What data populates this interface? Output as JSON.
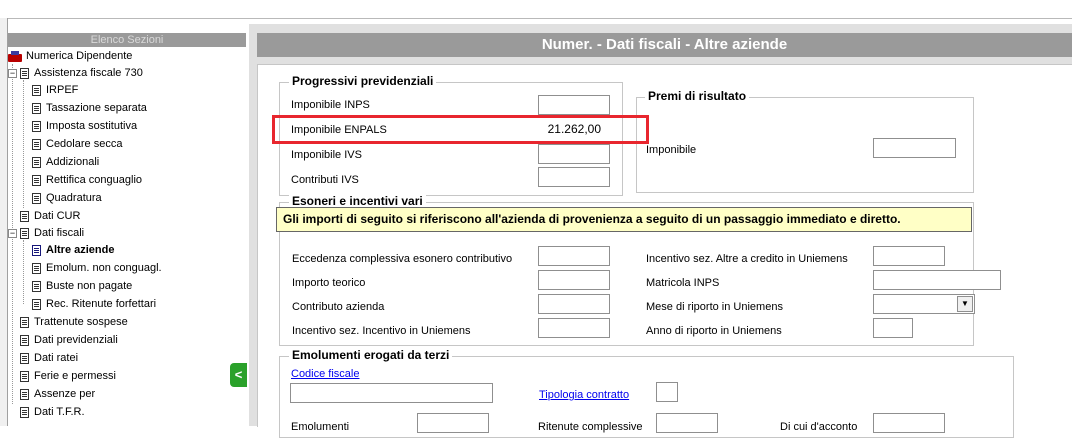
{
  "nav": {
    "header": "Elenco Sezioni",
    "collapse_glyph": "<",
    "items": [
      {
        "label": "Numerica Dipendente"
      },
      {
        "label": "Assistenza fiscale 730"
      },
      {
        "label": "IRPEF"
      },
      {
        "label": "Tassazione separata"
      },
      {
        "label": "Imposta sostitutiva"
      },
      {
        "label": "Cedolare secca"
      },
      {
        "label": "Addizionali"
      },
      {
        "label": "Rettifica conguaglio"
      },
      {
        "label": "Quadratura"
      },
      {
        "label": "Dati CUR"
      },
      {
        "label": "Dati fiscali"
      },
      {
        "label": "Altre aziende"
      },
      {
        "label": "Emolum. non conguagl."
      },
      {
        "label": "Buste non pagate"
      },
      {
        "label": "Rec. Ritenute forfettari"
      },
      {
        "label": "Trattenute sospese"
      },
      {
        "label": "Dati previdenziali"
      },
      {
        "label": "Dati ratei"
      },
      {
        "label": "Ferie e permessi"
      },
      {
        "label": "Assenze per"
      },
      {
        "label": "Dati T.F.R."
      }
    ]
  },
  "page": {
    "title": "Numer. - Dati fiscali - Altre aziende"
  },
  "progressivi": {
    "legend": "Progressivi previdenziali",
    "inps_label": "Imponibile INPS",
    "inps_value": "",
    "enpals_label": "Imponibile ENPALS",
    "enpals_value": "21.262,00",
    "ivs_label": "Imponibile IVS",
    "ivs_value": "",
    "contributi_label": "Contributi IVS",
    "contributi_value": ""
  },
  "premi": {
    "legend": "Premi di risultato",
    "imponibile_label": "Imponibile",
    "imponibile_value": ""
  },
  "esoneri": {
    "legend": "Esoneri e incentivi vari",
    "notice": "Gli importi di seguito si riferiscono all'azienda di provenienza a seguito di un passaggio immediato e diretto.",
    "eccedenza_label": "Eccedenza complessiva esonero contributivo",
    "importo_teorico_label": "Importo teorico",
    "contributo_azienda_label": "Contributo azienda",
    "incentivo_sez_label": "Incentivo sez. Incentivo in Uniemens",
    "incentivo_altre_label": "Incentivo sez. Altre a credito in Uniemens",
    "matricola_label": "Matricola INPS",
    "mese_label": "Mese di riporto in Uniemens",
    "anno_label": "Anno di riporto in Uniemens"
  },
  "emolumenti": {
    "legend": "Emolumenti erogati da terzi",
    "codice_fiscale_link": "Codice fiscale",
    "tipologia_link": "Tipologia contratto",
    "emolumenti_label": "Emolumenti",
    "ritenute_label": "Ritenute complessive",
    "di_cui_label": "Di cui d'acconto"
  },
  "colors": {
    "highlight": "#e8262e",
    "notice_bg": "#ffffc6",
    "header_gray": "#9a9a9a",
    "collapse_green": "#2aa12a"
  }
}
